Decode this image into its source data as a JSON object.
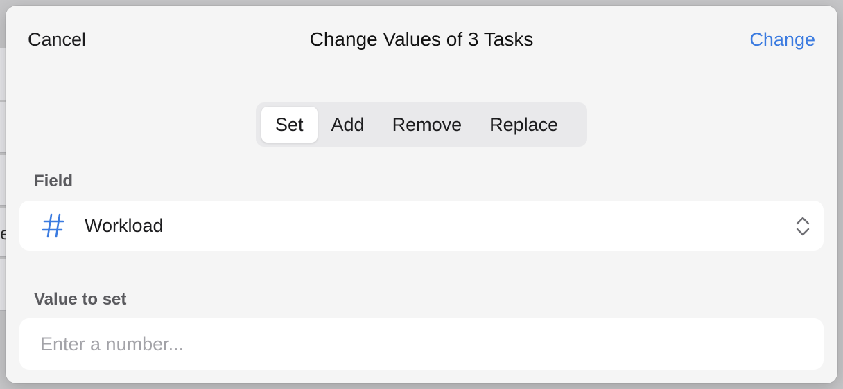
{
  "dialog": {
    "title": "Change Values of 3 Tasks",
    "cancel_label": "Cancel",
    "confirm_label": "Change"
  },
  "mode_picker": {
    "options": [
      "Set",
      "Add",
      "Remove",
      "Replace"
    ],
    "selected": "Set"
  },
  "field_section": {
    "label": "Field",
    "selected_field": "Workload",
    "field_icon": "hash-icon",
    "picker_icon": "up-down-chevron-icon"
  },
  "value_section": {
    "label": "Value to set",
    "value": "",
    "placeholder": "Enter a number..."
  },
  "background": {
    "peek_text": "e"
  },
  "colors": {
    "accent": "#3b7be0",
    "sheet_background": "#f5f5f5",
    "row_background": "#ffffff",
    "segment_track": "#e9e9eb"
  }
}
